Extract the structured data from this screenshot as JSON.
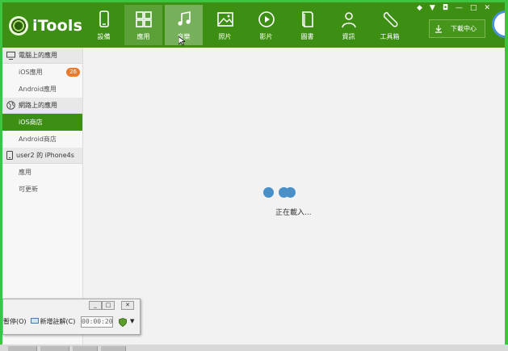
{
  "app": {
    "name": "iTools"
  },
  "nav": [
    {
      "label": "設備",
      "icon": "device-icon"
    },
    {
      "label": "應用",
      "icon": "apps-icon"
    },
    {
      "label": "音樂",
      "icon": "music-icon"
    },
    {
      "label": "照片",
      "icon": "photo-icon"
    },
    {
      "label": "影片",
      "icon": "video-icon"
    },
    {
      "label": "圖書",
      "icon": "book-icon"
    },
    {
      "label": "資訊",
      "icon": "person-icon"
    },
    {
      "label": "工具箱",
      "icon": "toolbox-icon"
    }
  ],
  "download_center": {
    "label": "下載中心"
  },
  "sidebar": {
    "sections": [
      {
        "title": "電腦上的應用",
        "icon": "computer-icon",
        "items": [
          {
            "label": "iOS應用",
            "badge": "26"
          },
          {
            "label": "Android應用"
          }
        ]
      },
      {
        "title": "網路上的應用",
        "icon": "globe-icon",
        "items": [
          {
            "label": "iOS商店",
            "active": true
          },
          {
            "label": "Android商店"
          }
        ]
      },
      {
        "title": "user2 的 iPhone4s",
        "icon": "phone-icon",
        "items": [
          {
            "label": "應用"
          },
          {
            "label": "可更新"
          }
        ]
      }
    ]
  },
  "content": {
    "loading_text": "正在載入..."
  },
  "recorder": {
    "pause_label": "暫停(O)",
    "new_comment_label": "新增註解(C)",
    "elapsed": "00:00:20"
  },
  "colors": {
    "header": "#3d8f13",
    "badge": "#e87a2d",
    "loading_dot": "#4a90c8"
  }
}
